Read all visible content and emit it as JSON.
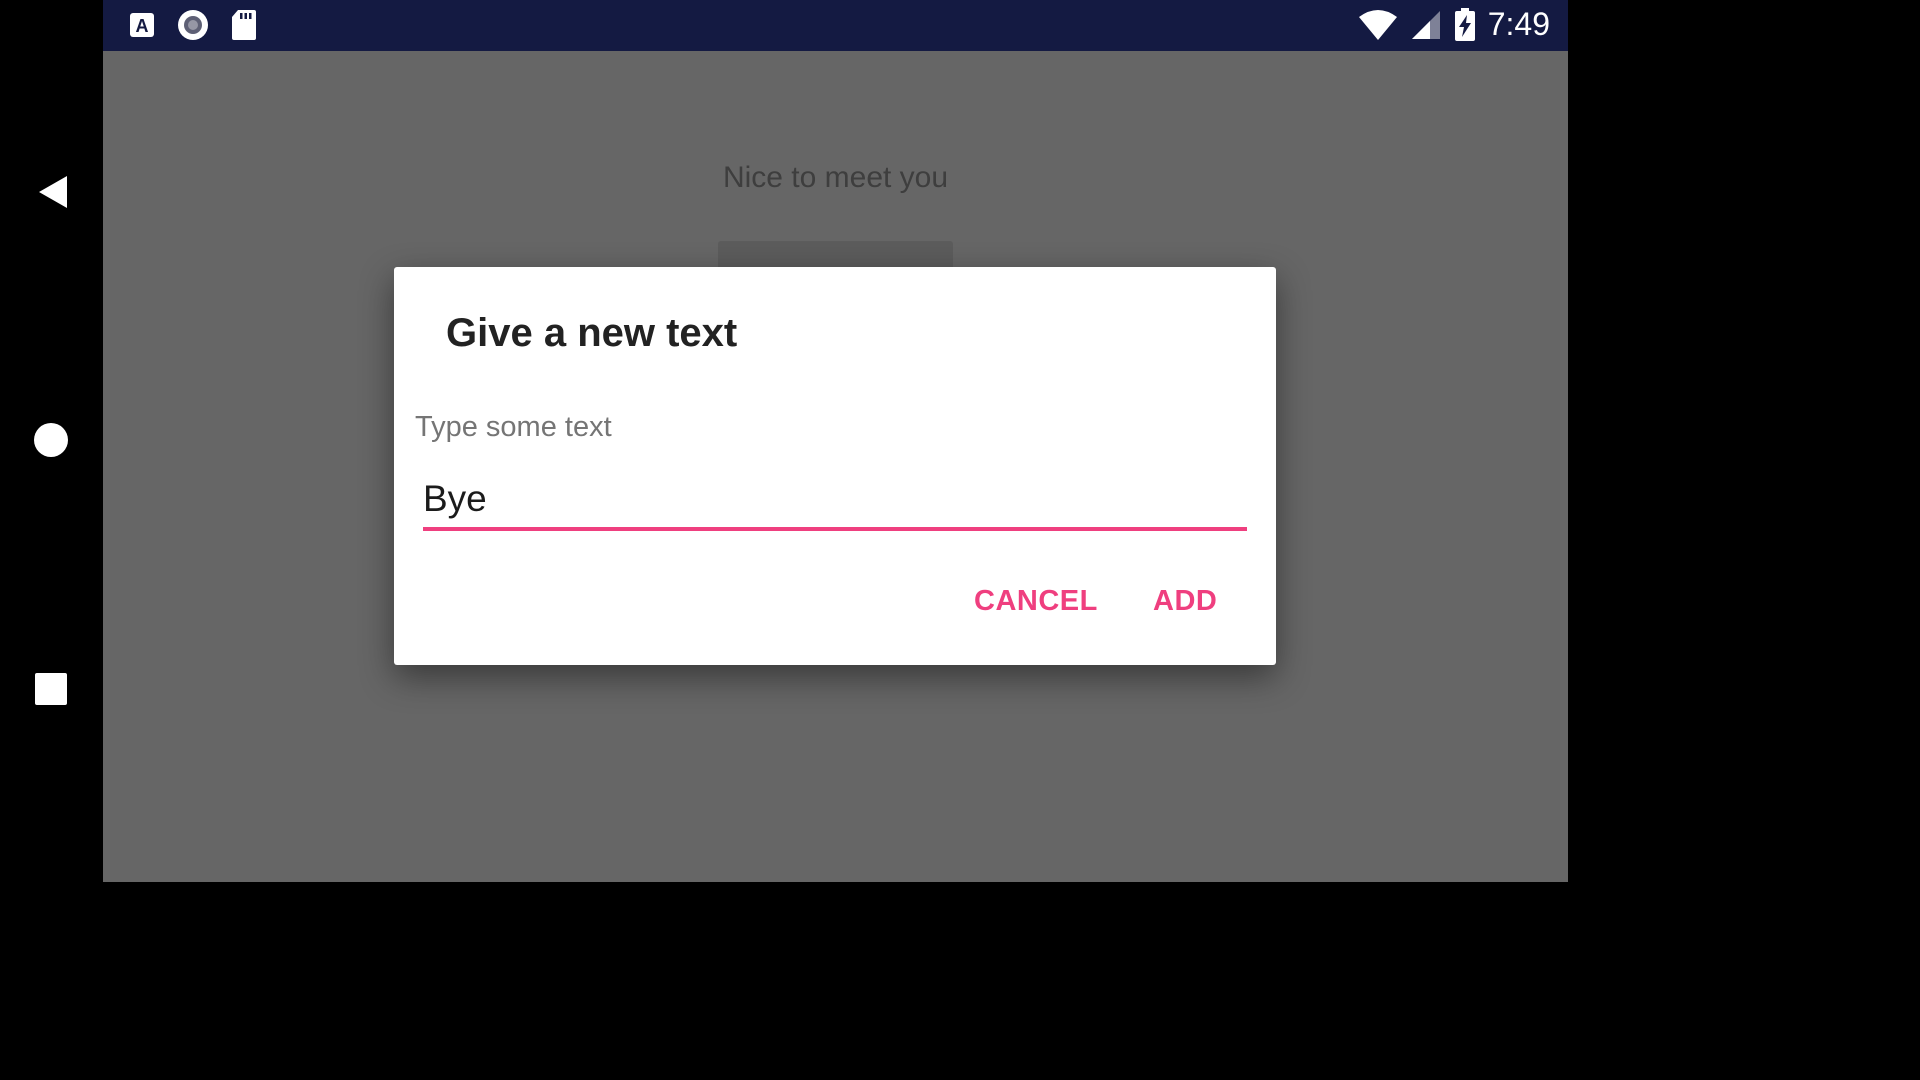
{
  "status_bar": {
    "time": "7:49",
    "icons": [
      "accessibility-a-icon",
      "record-icon",
      "sd-card-icon",
      "wifi-icon",
      "cell-signal-icon",
      "battery-charging-icon"
    ]
  },
  "navigation": {
    "icons": [
      "back-icon",
      "home-icon",
      "recents-icon"
    ]
  },
  "background": {
    "message": "Nice to meet you"
  },
  "dialog": {
    "title": "Give a new text",
    "input_hint": "Type some text",
    "input_value": "Bye",
    "cancel_label": "CANCEL",
    "add_label": "ADD"
  },
  "colors": {
    "accent": "#ef3f7f",
    "status_bar": "#141a42",
    "scrim": "#666666",
    "nav_bar": "#000000"
  }
}
